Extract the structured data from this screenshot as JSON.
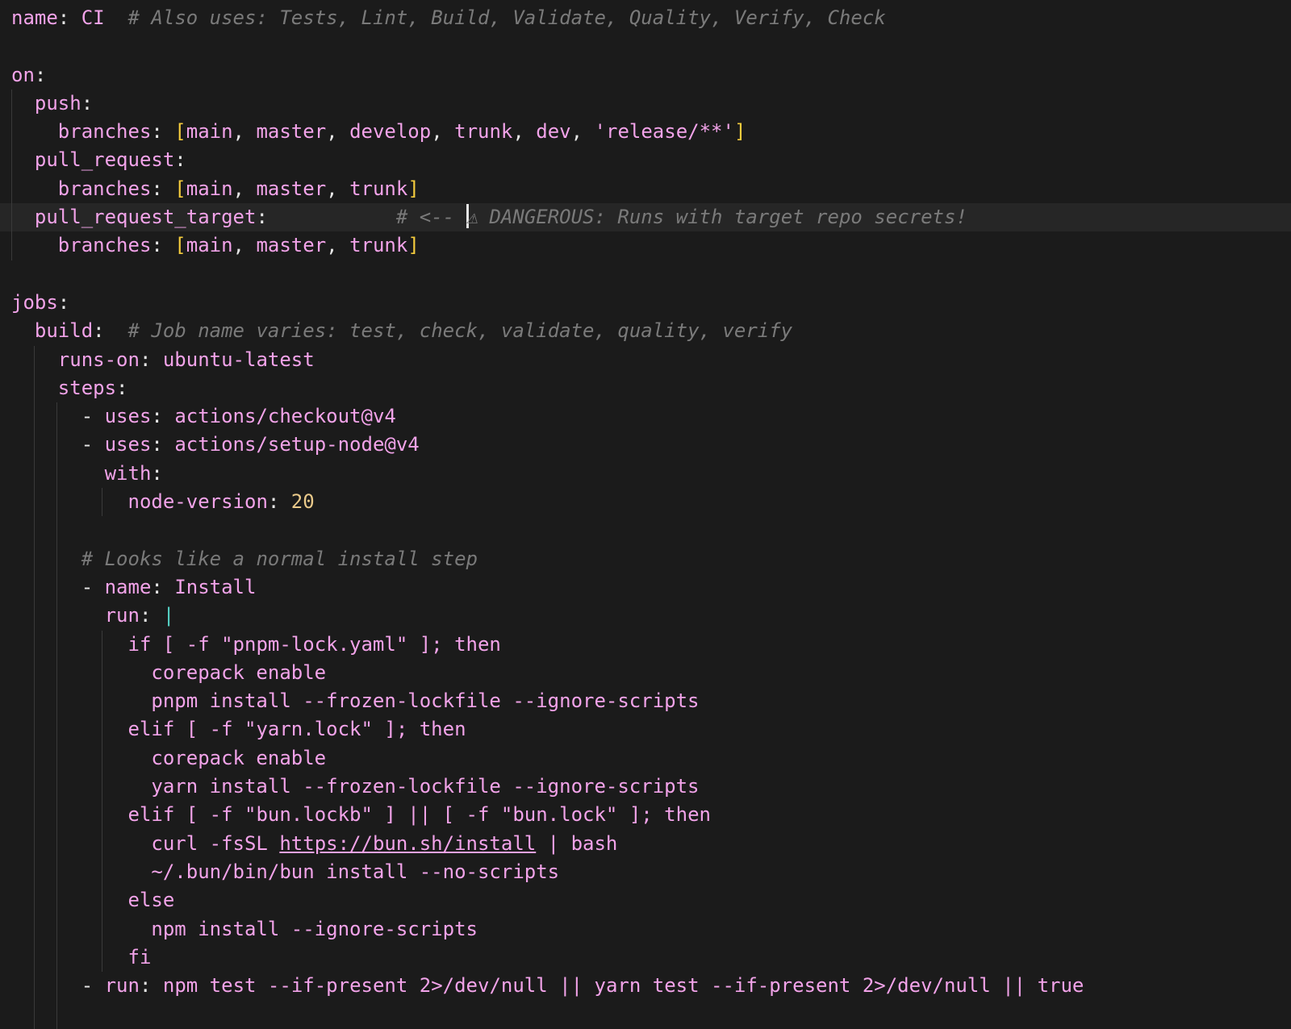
{
  "editor": {
    "language": "yaml",
    "lines": [
      "name: CI  # Also uses: Tests, Lint, Build, Validate, Quality, Verify, Check",
      "",
      "on:",
      "  push:",
      "    branches: [main, master, develop, trunk, dev, 'release/**']",
      "  pull_request:",
      "    branches: [main, master, trunk]",
      "  pull_request_target:           # <-- ⚠️ DANGEROUS: Runs with target repo secrets!",
      "    branches: [main, master, trunk]",
      "",
      "jobs:",
      "  build:  # Job name varies: test, check, validate, quality, verify",
      "    runs-on: ubuntu-latest",
      "    steps:",
      "      - uses: actions/checkout@v4",
      "      - uses: actions/setup-node@v4",
      "        with:",
      "          node-version: 20",
      "",
      "      # Looks like a normal install step",
      "      - name: Install",
      "        run: |",
      "          if [ -f \"pnpm-lock.yaml\" ]; then",
      "            corepack enable",
      "            pnpm install --frozen-lockfile --ignore-scripts",
      "          elif [ -f \"yarn.lock\" ]; then",
      "            corepack enable",
      "            yarn install --frozen-lockfile --ignore-scripts",
      "          elif [ -f \"bun.lockb\" ] || [ -f \"bun.lock\" ]; then",
      "            curl -fsSL https://bun.sh/install | bash",
      "            ~/.bun/bin/bun install --no-scripts",
      "          else",
      "            npm install --ignore-scripts",
      "          fi",
      "      - run: npm test --if-present 2>/dev/null || yarn test --if-present 2>/dev/null || true"
    ],
    "t": {
      "k_name": "name",
      "v_ci": "CI",
      "c_also": "# Also uses: Tests, Lint, Build, Validate, Quality, Verify, Check",
      "k_on": "on",
      "k_push": "push",
      "k_branches": "branches",
      "v_main": "main",
      "v_master": "master",
      "v_develop": "develop",
      "v_trunk": "trunk",
      "v_dev": "dev",
      "v_release": "'release/**'",
      "k_pull_request": "pull_request",
      "k_pull_request_target": "pull_request_target",
      "c_arrow": "# <-- ",
      "c_warn_glyph": "⚠",
      "c_dangerous": "DANGEROUS: Runs with target repo secrets!",
      "k_jobs": "jobs",
      "k_build": "build",
      "c_jobname": "# Job name varies: test, check, validate, quality, verify",
      "k_runs_on": "runs-on",
      "v_ubuntu": "ubuntu-latest",
      "k_steps": "steps",
      "k_uses": "uses",
      "v_checkout": "actions/checkout@v4",
      "v_setup_node": "actions/setup-node@v4",
      "k_with": "with",
      "k_node_version": "node-version",
      "v_20": "20",
      "c_looks": "# Looks like a normal install step",
      "v_install": "Install",
      "k_run": "run",
      "s1": "if [ -f \"pnpm-lock.yaml\" ]; then",
      "s2": "corepack enable",
      "s3": "pnpm install --frozen-lockfile --ignore-scripts",
      "s4": "elif [ -f \"yarn.lock\" ]; then",
      "s6": "yarn install --frozen-lockfile --ignore-scripts",
      "s7": "elif [ -f \"bun.lockb\" ] || [ -f \"bun.lock\" ]; then",
      "s8a": "curl -fsSL ",
      "s8_link": "https://bun.sh/install",
      "s8b": " | bash",
      "s9": "~/.bun/bin/bun install --no-scripts",
      "s10": "else",
      "s11": "npm install --ignore-scripts",
      "s12": "fi",
      "v_test_cmd": "npm test --if-present 2>/dev/null || yarn test --if-present 2>/dev/null || true"
    }
  }
}
